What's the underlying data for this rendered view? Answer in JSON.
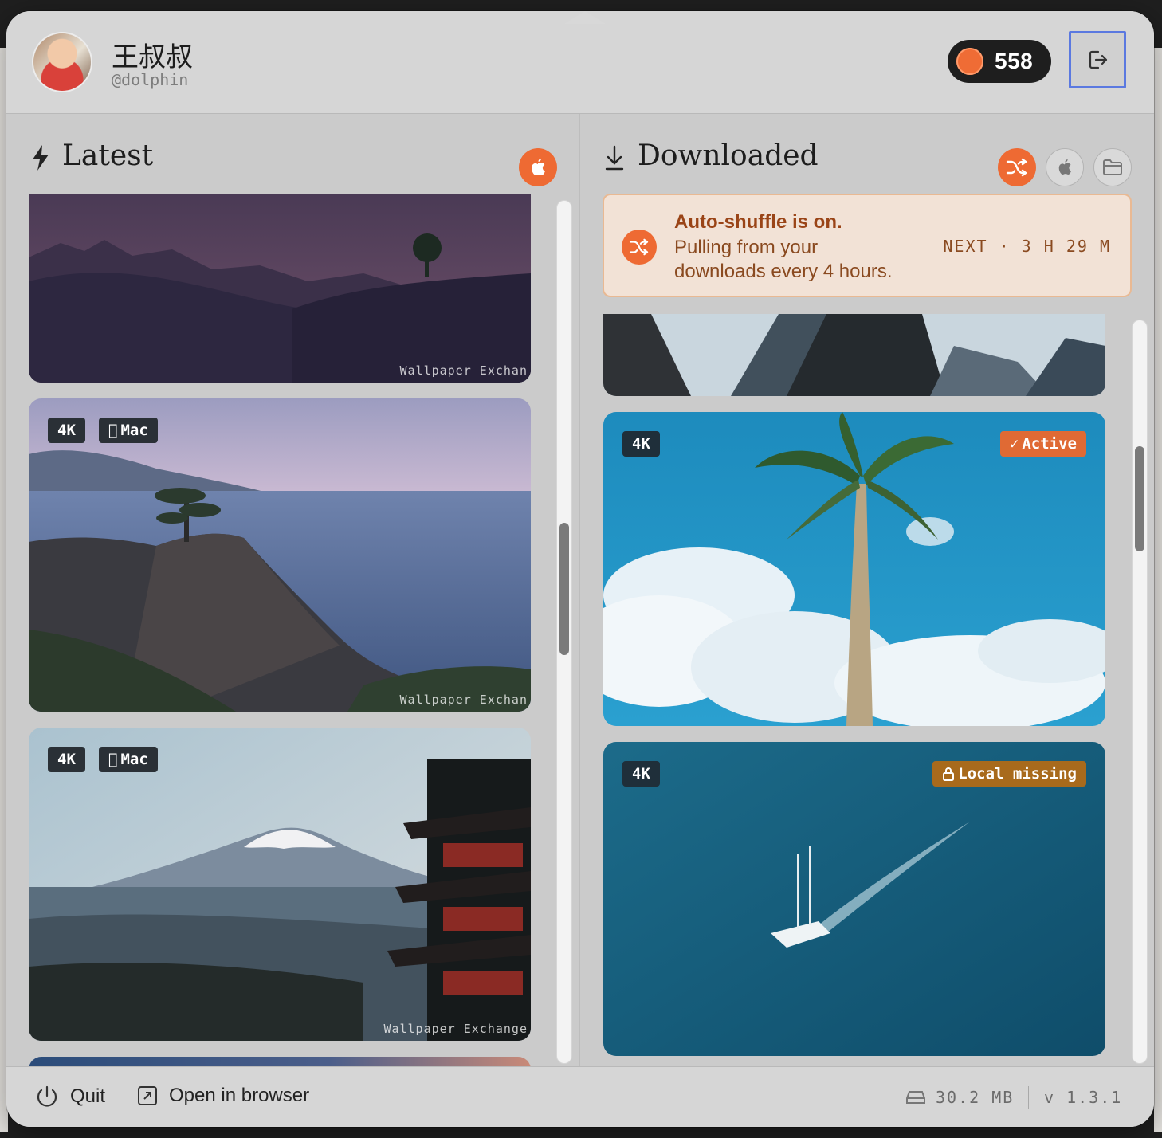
{
  "header": {
    "user_name": "王叔叔",
    "user_handle": "@dolphin",
    "coin_count": "558"
  },
  "latest": {
    "title": "Latest",
    "cards": [
      {
        "badges": [],
        "watermark": "Wallpaper Exchan"
      },
      {
        "badges": [
          "4K",
          "Mac"
        ],
        "watermark": "Wallpaper Exchan"
      },
      {
        "badges": [
          "4K",
          "Mac"
        ],
        "watermark": "Wallpaper Exchange"
      }
    ]
  },
  "downloaded": {
    "title": "Downloaded",
    "banner": {
      "title": "Auto-shuffle is on.",
      "line1": "Pulling from your",
      "line2": "downloads every 4 hours.",
      "next": "NEXT · 3 H 29 M"
    },
    "cards": [
      {
        "badge": "4K",
        "status": "Active"
      },
      {
        "badge": "4K",
        "status": "Local missing"
      }
    ]
  },
  "footer": {
    "quit_label": "Quit",
    "open_browser_label": "Open in browser",
    "storage": "30.2 MB",
    "version": "v 1.3.1"
  },
  "colors": {
    "accent": "#ee6a33",
    "focus_ring": "#5b79e0",
    "badge_dark": "#2a3036",
    "badge_missing": "#a86a1c"
  }
}
